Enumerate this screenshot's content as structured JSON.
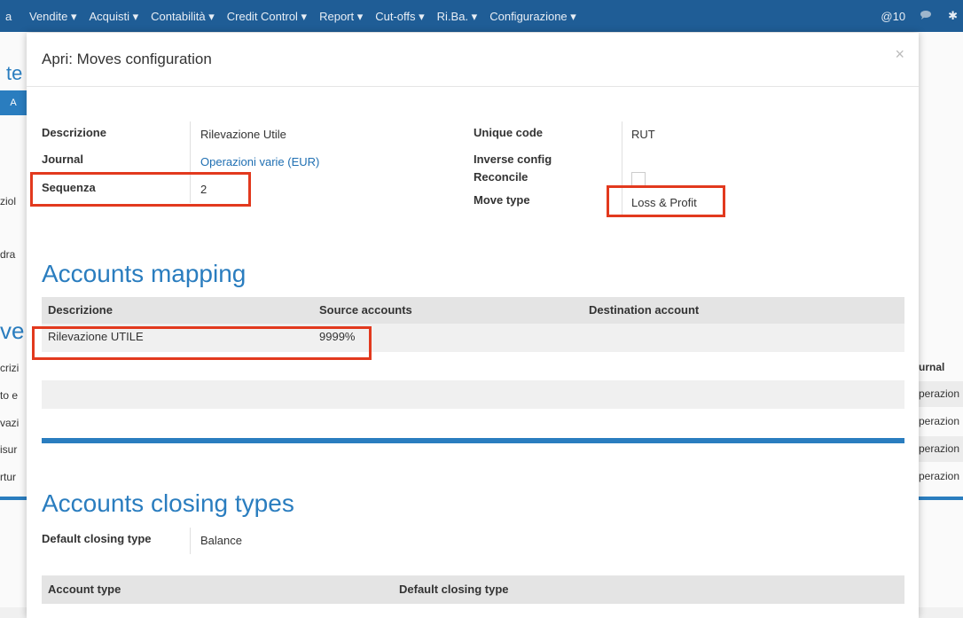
{
  "topbar": {
    "fragment": "a",
    "menu": [
      "Vendite ▾",
      "Acquisti ▾",
      "Contabilità ▾",
      "Credit Control ▾",
      "Report ▾",
      "Cut-offs ▾",
      "Ri.Ba. ▾",
      "Configurazione ▾"
    ],
    "notifications": "@10",
    "chat_icon": "chat-icon",
    "extra": "✱"
  },
  "background": {
    "title_fragment": "j te",
    "button_fragment": "A",
    "left_texts": [
      "ziol",
      "dra",
      "crizi",
      "to e",
      "vazi",
      "isur",
      "rtur"
    ],
    "big_fragment": "ve",
    "right_header": "urnal",
    "right_rows": [
      "perazion",
      "perazion",
      "perazion",
      "perazion"
    ]
  },
  "modal": {
    "title": "Apri: Moves configuration",
    "close": "×",
    "fields": {
      "descrizione_label": "Descrizione",
      "descrizione_value": "Rilevazione Utile",
      "journal_label": "Journal",
      "journal_value": "Operazioni varie (EUR)",
      "sequenza_label": "Sequenza",
      "sequenza_value": "2",
      "unique_code_label": "Unique code",
      "unique_code_value": "RUT",
      "inverse_label_1": "Inverse config",
      "inverse_label_2": "Reconcile",
      "inverse_checked": false,
      "move_type_label": "Move type",
      "move_type_value": "Loss & Profit"
    },
    "mapping": {
      "heading": "Accounts mapping",
      "columns": [
        "Descrizione",
        "Source accounts",
        "Destination account"
      ],
      "rows": [
        {
          "descrizione": "Rilevazione UTILE",
          "source": "9999%",
          "destination": ""
        }
      ]
    },
    "closing": {
      "heading": "Accounts closing types",
      "default_label": "Default closing type",
      "default_value": "Balance",
      "columns": [
        "Account type",
        "Default closing type"
      ]
    }
  },
  "colors": {
    "accent": "#2a7dbf",
    "topbar": "#1f5d96",
    "highlight": "#e2391e",
    "link": "#1f6fb2"
  }
}
